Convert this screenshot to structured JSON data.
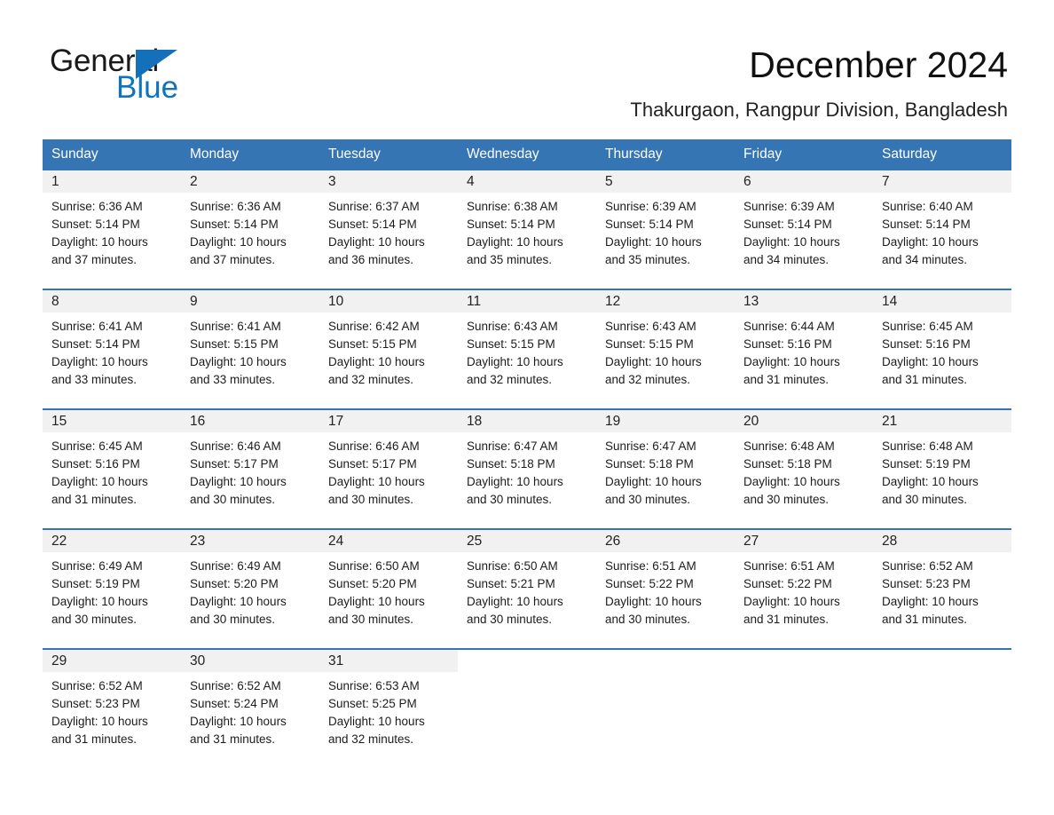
{
  "brand": {
    "name_part1": "General",
    "name_part2": "Blue",
    "triangle_color": "#1570ba",
    "blue_color": "#0f74bd"
  },
  "header": {
    "title": "December 2024",
    "subtitle": "Thakurgaon, Rangpur Division, Bangladesh",
    "accent_color": "#3575b4",
    "daynum_bg": "#f1f1f1"
  },
  "weekdays": [
    "Sunday",
    "Monday",
    "Tuesday",
    "Wednesday",
    "Thursday",
    "Friday",
    "Saturday"
  ],
  "labels": {
    "sunrise_prefix": "Sunrise:",
    "sunset_prefix": "Sunset:",
    "daylight_prefix": "Daylight:"
  },
  "weeks": [
    [
      {
        "day": "1",
        "sunrise": "Sunrise: 6:36 AM",
        "sunset": "Sunset: 5:14 PM",
        "daylight1": "Daylight: 10 hours",
        "daylight2": "and 37 minutes."
      },
      {
        "day": "2",
        "sunrise": "Sunrise: 6:36 AM",
        "sunset": "Sunset: 5:14 PM",
        "daylight1": "Daylight: 10 hours",
        "daylight2": "and 37 minutes."
      },
      {
        "day": "3",
        "sunrise": "Sunrise: 6:37 AM",
        "sunset": "Sunset: 5:14 PM",
        "daylight1": "Daylight: 10 hours",
        "daylight2": "and 36 minutes."
      },
      {
        "day": "4",
        "sunrise": "Sunrise: 6:38 AM",
        "sunset": "Sunset: 5:14 PM",
        "daylight1": "Daylight: 10 hours",
        "daylight2": "and 35 minutes."
      },
      {
        "day": "5",
        "sunrise": "Sunrise: 6:39 AM",
        "sunset": "Sunset: 5:14 PM",
        "daylight1": "Daylight: 10 hours",
        "daylight2": "and 35 minutes."
      },
      {
        "day": "6",
        "sunrise": "Sunrise: 6:39 AM",
        "sunset": "Sunset: 5:14 PM",
        "daylight1": "Daylight: 10 hours",
        "daylight2": "and 34 minutes."
      },
      {
        "day": "7",
        "sunrise": "Sunrise: 6:40 AM",
        "sunset": "Sunset: 5:14 PM",
        "daylight1": "Daylight: 10 hours",
        "daylight2": "and 34 minutes."
      }
    ],
    [
      {
        "day": "8",
        "sunrise": "Sunrise: 6:41 AM",
        "sunset": "Sunset: 5:14 PM",
        "daylight1": "Daylight: 10 hours",
        "daylight2": "and 33 minutes."
      },
      {
        "day": "9",
        "sunrise": "Sunrise: 6:41 AM",
        "sunset": "Sunset: 5:15 PM",
        "daylight1": "Daylight: 10 hours",
        "daylight2": "and 33 minutes."
      },
      {
        "day": "10",
        "sunrise": "Sunrise: 6:42 AM",
        "sunset": "Sunset: 5:15 PM",
        "daylight1": "Daylight: 10 hours",
        "daylight2": "and 32 minutes."
      },
      {
        "day": "11",
        "sunrise": "Sunrise: 6:43 AM",
        "sunset": "Sunset: 5:15 PM",
        "daylight1": "Daylight: 10 hours",
        "daylight2": "and 32 minutes."
      },
      {
        "day": "12",
        "sunrise": "Sunrise: 6:43 AM",
        "sunset": "Sunset: 5:15 PM",
        "daylight1": "Daylight: 10 hours",
        "daylight2": "and 32 minutes."
      },
      {
        "day": "13",
        "sunrise": "Sunrise: 6:44 AM",
        "sunset": "Sunset: 5:16 PM",
        "daylight1": "Daylight: 10 hours",
        "daylight2": "and 31 minutes."
      },
      {
        "day": "14",
        "sunrise": "Sunrise: 6:45 AM",
        "sunset": "Sunset: 5:16 PM",
        "daylight1": "Daylight: 10 hours",
        "daylight2": "and 31 minutes."
      }
    ],
    [
      {
        "day": "15",
        "sunrise": "Sunrise: 6:45 AM",
        "sunset": "Sunset: 5:16 PM",
        "daylight1": "Daylight: 10 hours",
        "daylight2": "and 31 minutes."
      },
      {
        "day": "16",
        "sunrise": "Sunrise: 6:46 AM",
        "sunset": "Sunset: 5:17 PM",
        "daylight1": "Daylight: 10 hours",
        "daylight2": "and 30 minutes."
      },
      {
        "day": "17",
        "sunrise": "Sunrise: 6:46 AM",
        "sunset": "Sunset: 5:17 PM",
        "daylight1": "Daylight: 10 hours",
        "daylight2": "and 30 minutes."
      },
      {
        "day": "18",
        "sunrise": "Sunrise: 6:47 AM",
        "sunset": "Sunset: 5:18 PM",
        "daylight1": "Daylight: 10 hours",
        "daylight2": "and 30 minutes."
      },
      {
        "day": "19",
        "sunrise": "Sunrise: 6:47 AM",
        "sunset": "Sunset: 5:18 PM",
        "daylight1": "Daylight: 10 hours",
        "daylight2": "and 30 minutes."
      },
      {
        "day": "20",
        "sunrise": "Sunrise: 6:48 AM",
        "sunset": "Sunset: 5:18 PM",
        "daylight1": "Daylight: 10 hours",
        "daylight2": "and 30 minutes."
      },
      {
        "day": "21",
        "sunrise": "Sunrise: 6:48 AM",
        "sunset": "Sunset: 5:19 PM",
        "daylight1": "Daylight: 10 hours",
        "daylight2": "and 30 minutes."
      }
    ],
    [
      {
        "day": "22",
        "sunrise": "Sunrise: 6:49 AM",
        "sunset": "Sunset: 5:19 PM",
        "daylight1": "Daylight: 10 hours",
        "daylight2": "and 30 minutes."
      },
      {
        "day": "23",
        "sunrise": "Sunrise: 6:49 AM",
        "sunset": "Sunset: 5:20 PM",
        "daylight1": "Daylight: 10 hours",
        "daylight2": "and 30 minutes."
      },
      {
        "day": "24",
        "sunrise": "Sunrise: 6:50 AM",
        "sunset": "Sunset: 5:20 PM",
        "daylight1": "Daylight: 10 hours",
        "daylight2": "and 30 minutes."
      },
      {
        "day": "25",
        "sunrise": "Sunrise: 6:50 AM",
        "sunset": "Sunset: 5:21 PM",
        "daylight1": "Daylight: 10 hours",
        "daylight2": "and 30 minutes."
      },
      {
        "day": "26",
        "sunrise": "Sunrise: 6:51 AM",
        "sunset": "Sunset: 5:22 PM",
        "daylight1": "Daylight: 10 hours",
        "daylight2": "and 30 minutes."
      },
      {
        "day": "27",
        "sunrise": "Sunrise: 6:51 AM",
        "sunset": "Sunset: 5:22 PM",
        "daylight1": "Daylight: 10 hours",
        "daylight2": "and 31 minutes."
      },
      {
        "day": "28",
        "sunrise": "Sunrise: 6:52 AM",
        "sunset": "Sunset: 5:23 PM",
        "daylight1": "Daylight: 10 hours",
        "daylight2": "and 31 minutes."
      }
    ],
    [
      {
        "day": "29",
        "sunrise": "Sunrise: 6:52 AM",
        "sunset": "Sunset: 5:23 PM",
        "daylight1": "Daylight: 10 hours",
        "daylight2": "and 31 minutes."
      },
      {
        "day": "30",
        "sunrise": "Sunrise: 6:52 AM",
        "sunset": "Sunset: 5:24 PM",
        "daylight1": "Daylight: 10 hours",
        "daylight2": "and 31 minutes."
      },
      {
        "day": "31",
        "sunrise": "Sunrise: 6:53 AM",
        "sunset": "Sunset: 5:25 PM",
        "daylight1": "Daylight: 10 hours",
        "daylight2": "and 32 minutes."
      },
      {
        "day": "",
        "sunrise": "",
        "sunset": "",
        "daylight1": "",
        "daylight2": ""
      },
      {
        "day": "",
        "sunrise": "",
        "sunset": "",
        "daylight1": "",
        "daylight2": ""
      },
      {
        "day": "",
        "sunrise": "",
        "sunset": "",
        "daylight1": "",
        "daylight2": ""
      },
      {
        "day": "",
        "sunrise": "",
        "sunset": "",
        "daylight1": "",
        "daylight2": ""
      }
    ]
  ]
}
